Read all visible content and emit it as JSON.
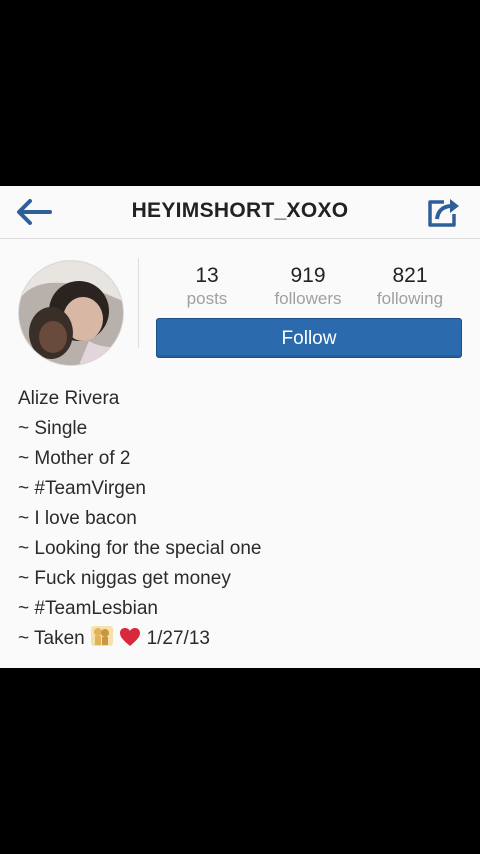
{
  "header": {
    "title": "HEYIMSHORT_XOXO",
    "back_icon": "arrow-left-icon",
    "share_icon": "share-icon"
  },
  "profile": {
    "avatar": "profile-photo",
    "stats": [
      {
        "count": "13",
        "label": "posts"
      },
      {
        "count": "919",
        "label": "followers"
      },
      {
        "count": "821",
        "label": "following"
      }
    ],
    "follow_label": "Follow"
  },
  "bio": {
    "name": "Alize Rivera",
    "lines": [
      "~ Single",
      "~ Mother of 2",
      "~ #TeamVirgen",
      "~ I love bacon",
      "~ Looking for the special one",
      "~ Fuck niggas get money",
      "~ #TeamLesbian"
    ],
    "last_line": {
      "prefix": "~ Taken",
      "emoji": [
        "couple-kiss-emoji",
        "red-heart-emoji"
      ],
      "date": "1/27/13"
    }
  },
  "colors": {
    "accent": "#2b6bad",
    "back_arrow": "#2f5f99"
  }
}
